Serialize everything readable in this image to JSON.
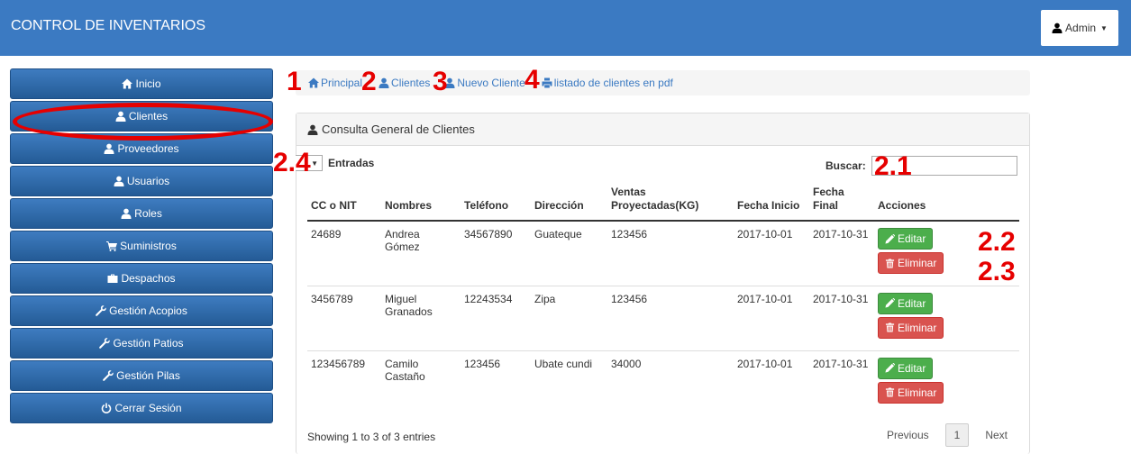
{
  "header": {
    "title": "CONTROL DE INVENTARIOS",
    "user_label": "Admin"
  },
  "sidebar": {
    "items": [
      {
        "label": "Inicio",
        "icon": "home-icon"
      },
      {
        "label": "Clientes",
        "icon": "user-icon"
      },
      {
        "label": "Proveedores",
        "icon": "user-icon"
      },
      {
        "label": "Usuarios",
        "icon": "user-icon"
      },
      {
        "label": "Roles",
        "icon": "user-icon"
      },
      {
        "label": "Suministros",
        "icon": "cart-icon"
      },
      {
        "label": "Despachos",
        "icon": "briefcase-icon"
      },
      {
        "label": "Gestión Acopios",
        "icon": "wrench-icon"
      },
      {
        "label": "Gestión Patios",
        "icon": "wrench-icon"
      },
      {
        "label": "Gestión Pilas",
        "icon": "wrench-icon"
      },
      {
        "label": "Cerrar Sesión",
        "icon": "power-icon"
      }
    ]
  },
  "breadcrumb": {
    "items": [
      {
        "label": "Principal",
        "icon": "home-icon"
      },
      {
        "label": "Clientes",
        "icon": "user-icon"
      },
      {
        "label": "Nuevo Cliente",
        "icon": "user-icon"
      },
      {
        "label": "listado de clientes en pdf",
        "icon": "print-icon"
      }
    ]
  },
  "annotations": {
    "n1": "1",
    "n2": "2",
    "n3": "3",
    "n4": "4",
    "n21": "2.1",
    "n22": "2.2",
    "n23": "2.3",
    "n24": "2.4"
  },
  "panel": {
    "title": "Consulta General de Clientes",
    "entries_label": "Entradas",
    "search_label": "Buscar:",
    "search_value": ""
  },
  "table": {
    "headers": [
      "CC o NIT",
      "Nombres",
      "Teléfono",
      "Dirección",
      "Ventas Proyectadas(KG)",
      "Fecha Inicio",
      "Fecha Final",
      "Acciones"
    ],
    "edit_label": "Editar",
    "delete_label": "Eliminar",
    "rows": [
      {
        "id": "24689",
        "name": "Andrea Gómez",
        "phone": "34567890",
        "address": "Guateque",
        "sales": "123456",
        "start": "2017-10-01",
        "end": "2017-10-31"
      },
      {
        "id": "3456789",
        "name": "Miguel Granados",
        "phone": "12243534",
        "address": "Zipa",
        "sales": "123456",
        "start": "2017-10-01",
        "end": "2017-10-31"
      },
      {
        "id": "123456789",
        "name": "Camilo Castaño",
        "phone": "123456",
        "address": "Ubate cundi",
        "sales": "34000",
        "start": "2017-10-01",
        "end": "2017-10-31"
      }
    ]
  },
  "footer": {
    "info": "Showing 1 to 3 of 3 entries",
    "previous": "Previous",
    "page": "1",
    "next": "Next"
  },
  "colors": {
    "navbar": "#3b7ac2",
    "annotation": "#e60000",
    "edit": "#4cae4c",
    "delete": "#d9534f"
  }
}
